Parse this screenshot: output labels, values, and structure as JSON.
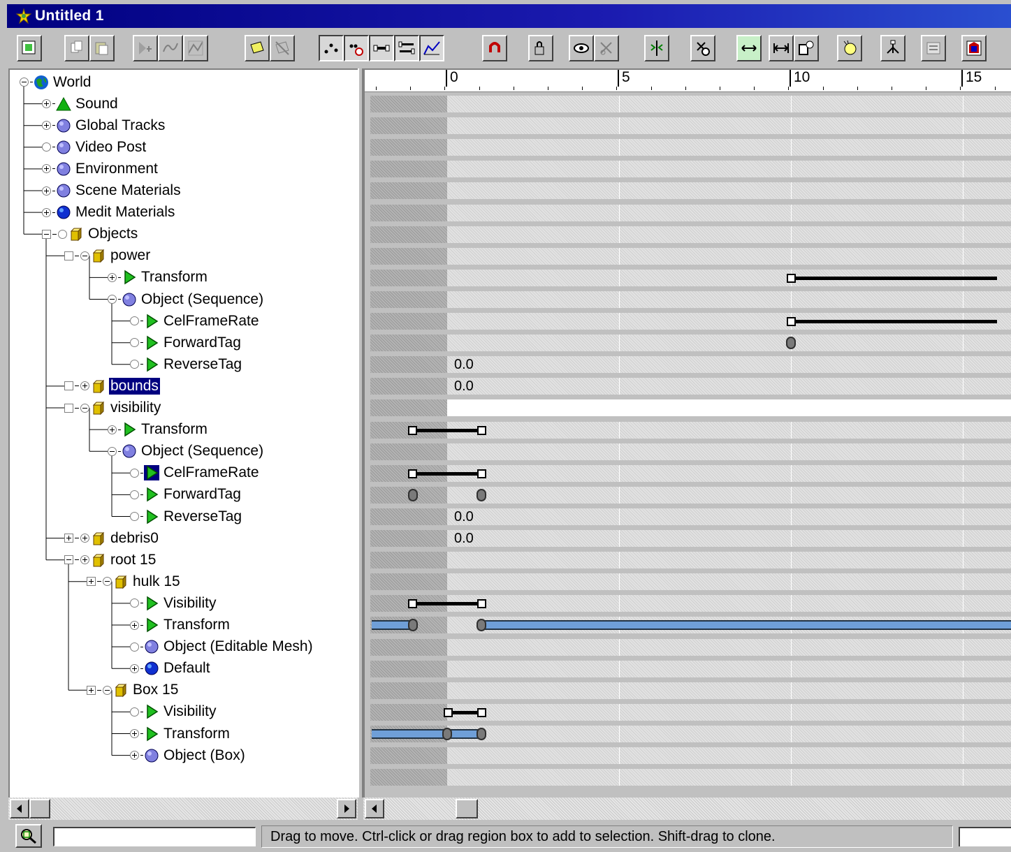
{
  "window": {
    "title": "Untitled 1"
  },
  "toolbar": {
    "buttons": [
      {
        "icon": "filter-icon"
      },
      {
        "icon": "copy-icon"
      },
      {
        "icon": "paste-icon"
      },
      {
        "icon": "add-visibility-track-icon"
      },
      {
        "icon": "edit-curve-icon"
      },
      {
        "icon": "function-curve-icon"
      },
      {
        "icon": "note-track-icon"
      },
      {
        "icon": "delete-note-icon"
      },
      {
        "icon": "edit-keys-icon"
      },
      {
        "icon": "position-ranges-icon"
      },
      {
        "icon": "edit-time-icon"
      },
      {
        "icon": "edit-ranges-icon"
      },
      {
        "icon": "function-curves-icon"
      },
      {
        "icon": "snap-frames-icon"
      },
      {
        "icon": "lock-selection-icon"
      },
      {
        "icon": "show-visibility-icon"
      },
      {
        "icon": "delete-key-icon"
      },
      {
        "icon": "align-keys-icon"
      },
      {
        "icon": "reduce-keys-icon"
      },
      {
        "icon": "slide-keys-icon"
      },
      {
        "icon": "scale-keys-icon"
      },
      {
        "icon": "insert-time-icon"
      },
      {
        "icon": "add-keys-icon"
      },
      {
        "icon": "hierarchy-icon"
      },
      {
        "icon": "properties-icon"
      },
      {
        "icon": "controller-icon"
      }
    ]
  },
  "tree": {
    "items": [
      {
        "label": "World",
        "icon": "world-icon"
      },
      {
        "label": "Sound",
        "icon": "sound-icon"
      },
      {
        "label": "Global Tracks",
        "icon": "sphere-icon"
      },
      {
        "label": "Video Post",
        "icon": "sphere-icon"
      },
      {
        "label": "Environment",
        "icon": "sphere-icon"
      },
      {
        "label": "Scene Materials",
        "icon": "sphere-icon"
      },
      {
        "label": "Medit Materials",
        "icon": "blue-sphere-icon"
      },
      {
        "label": "Objects",
        "icon": "cube-icon"
      },
      {
        "label": "power",
        "icon": "cube-icon"
      },
      {
        "label": "Transform",
        "icon": "triangle-icon"
      },
      {
        "label": "Object (Sequence)",
        "icon": "sphere-icon"
      },
      {
        "label": "CelFrameRate",
        "icon": "triangle-icon"
      },
      {
        "label": "ForwardTag",
        "icon": "triangle-icon"
      },
      {
        "label": "ReverseTag",
        "icon": "triangle-icon"
      },
      {
        "label": "bounds",
        "icon": "cube-icon"
      },
      {
        "label": "visibility",
        "icon": "cube-icon"
      },
      {
        "label": "Transform",
        "icon": "triangle-icon"
      },
      {
        "label": "Object (Sequence)",
        "icon": "sphere-icon"
      },
      {
        "label": "CelFrameRate",
        "icon": "triangle-icon"
      },
      {
        "label": "ForwardTag",
        "icon": "triangle-icon"
      },
      {
        "label": "ReverseTag",
        "icon": "triangle-icon"
      },
      {
        "label": "debris0",
        "icon": "cube-icon"
      },
      {
        "label": "root 15",
        "icon": "cube-icon"
      },
      {
        "label": "hulk 15",
        "icon": "cube-icon"
      },
      {
        "label": "Visibility",
        "icon": "triangle-icon"
      },
      {
        "label": "Transform",
        "icon": "triangle-icon"
      },
      {
        "label": "Object (Editable Mesh)",
        "icon": "sphere-icon"
      },
      {
        "label": "Default",
        "icon": "blue-sphere-icon"
      },
      {
        "label": "Box 15",
        "icon": "cube-icon"
      },
      {
        "label": "Visibility",
        "icon": "triangle-icon"
      },
      {
        "label": "Transform",
        "icon": "triangle-icon"
      },
      {
        "label": "Object (Box)",
        "icon": "sphere-icon"
      }
    ]
  },
  "ruler": {
    "labels": [
      "0",
      "5",
      "10",
      "15"
    ]
  },
  "tracks": {
    "values": {
      "forward_tag_1": "0.0",
      "reverse_tag_1": "0.0",
      "forward_tag_2": "0.0",
      "reverse_tag_2": "0.0"
    }
  },
  "status": {
    "message": "Drag to move. Ctrl-click or drag region box to add to selection. Shift-drag to clone."
  },
  "colors": {
    "title_bar": "#000080",
    "selection": "#000080",
    "visibility_bar": "#6f9fd8"
  }
}
